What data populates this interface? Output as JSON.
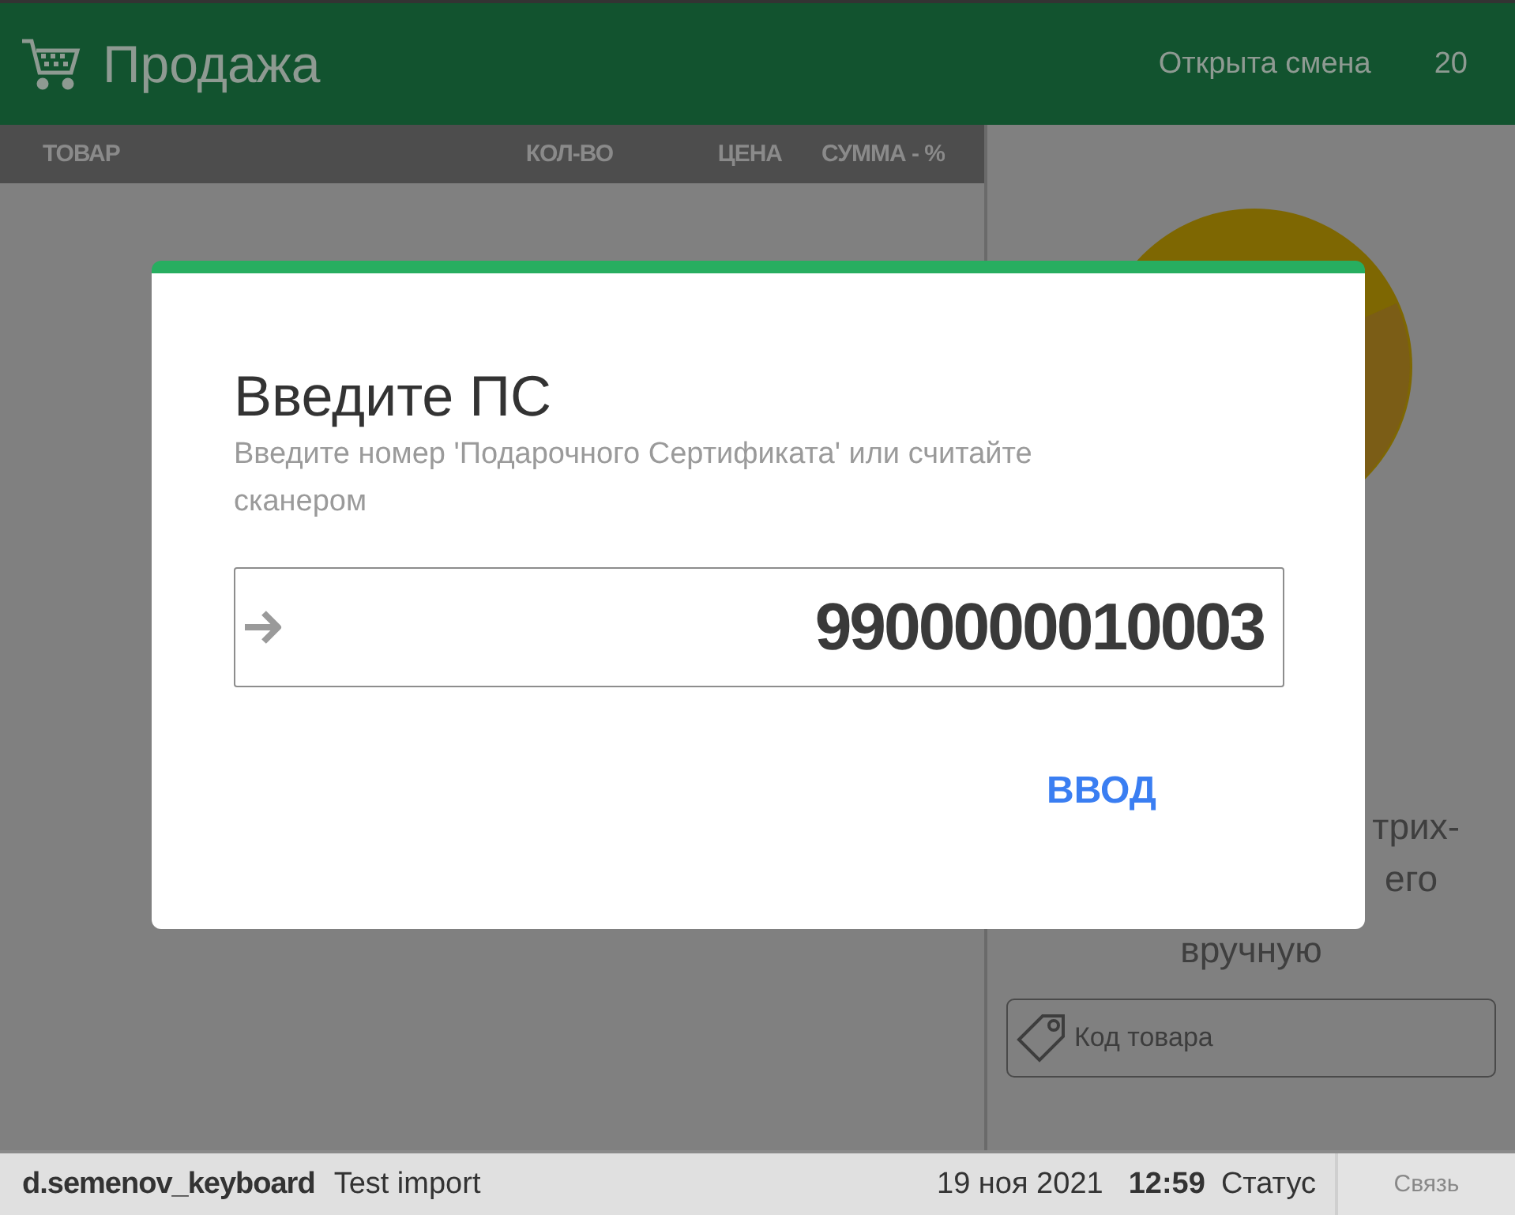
{
  "header": {
    "title": "Продажа",
    "shift_status": "Открыта смена",
    "shift_number": "20"
  },
  "table": {
    "columns": [
      "ТОВАР",
      "КОЛ-ВО",
      "ЦЕНА",
      "СУММА - %"
    ]
  },
  "scan_hint": {
    "lines": [
      "трих-",
      "его",
      "вручную"
    ]
  },
  "product_code": {
    "placeholder": "Код товара"
  },
  "dialog": {
    "title": "Введите ПС",
    "subtitle": "Введите номер 'Подарочного Сертификата' или считайте сканером",
    "input": {
      "value": "9900000010003"
    },
    "button": "ВВОД"
  },
  "status_bar": {
    "user": "d.semenov_keyboard",
    "store": "Test import",
    "date": "19 ноя 2021",
    "time": "12:59",
    "status": "Статус",
    "connection_button": "Связь"
  }
}
